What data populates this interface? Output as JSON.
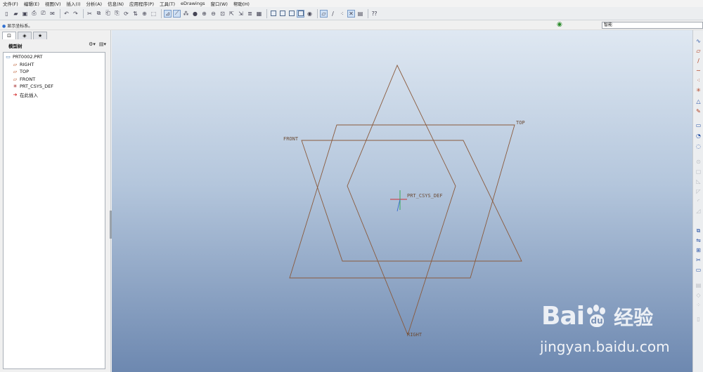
{
  "menu": [
    "文件(F)",
    "编辑(E)",
    "视图(V)",
    "插入(I)",
    "分析(A)",
    "信息(N)",
    "应用程序(P)",
    "工具(T)",
    "eDrawings",
    "窗口(W)",
    "帮助(H)"
  ],
  "status": {
    "message": "显示坐标系。",
    "filter_value": "智能"
  },
  "tabs": [
    "⊡",
    "◈",
    "★"
  ],
  "model_tree": {
    "title": "模型树",
    "items": [
      {
        "label": "PRT0002.PRT",
        "icon": "part-icon"
      },
      {
        "label": "RIGHT",
        "icon": "datum-plane-icon"
      },
      {
        "label": "TOP",
        "icon": "datum-plane-icon"
      },
      {
        "label": "FRONT",
        "icon": "datum-plane-icon"
      },
      {
        "label": "PRT_CSYS_DEF",
        "icon": "coordinate-system-icon"
      },
      {
        "label": "在此插入",
        "icon": "insert-here-arrow-icon"
      }
    ]
  },
  "viewport": {
    "plane_labels": {
      "top": "TOP",
      "front": "FRONT",
      "right": "RIGHT",
      "csys": "PRT_CSYS_DEF"
    },
    "plane_color": "#8a5a3c"
  },
  "watermark": {
    "brand": "Bai",
    "brand_suffix": "du",
    "cn": "经验",
    "url": "jingyan.baidu.com"
  }
}
